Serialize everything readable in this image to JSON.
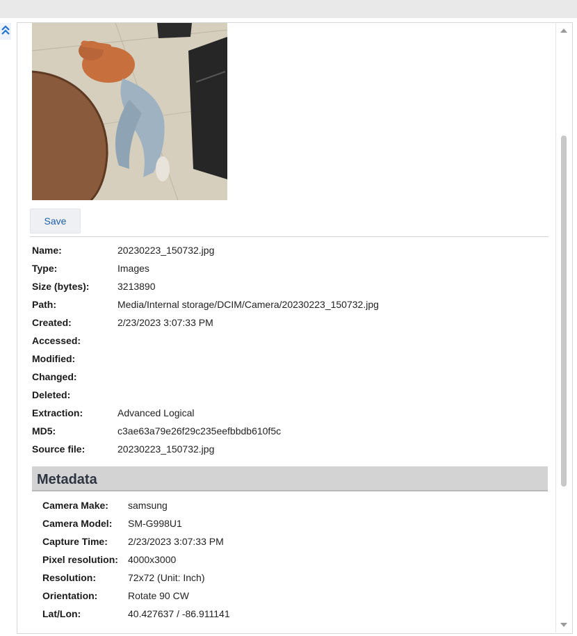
{
  "toolbar": {
    "save_label": "Save"
  },
  "properties": [
    {
      "label": "Name:",
      "value": "20230223_150732.jpg"
    },
    {
      "label": "Type:",
      "value": "Images"
    },
    {
      "label": "Size (bytes):",
      "value": "3213890"
    },
    {
      "label": "Path:",
      "value": "Media/Internal storage/DCIM/Camera/20230223_150732.jpg"
    },
    {
      "label": "Created:",
      "value": "2/23/2023 3:07:33 PM"
    },
    {
      "label": "Accessed:",
      "value": ""
    },
    {
      "label": "Modified:",
      "value": ""
    },
    {
      "label": "Changed:",
      "value": ""
    },
    {
      "label": "Deleted:",
      "value": ""
    },
    {
      "label": "Extraction:",
      "value": "Advanced Logical"
    },
    {
      "label": "MD5:",
      "value": "c3ae63a79e26f29c235eefbbdb610f5c"
    },
    {
      "label": "Source file:",
      "value": "20230223_150732.jpg"
    }
  ],
  "metadata": {
    "title": "Metadata",
    "rows": [
      {
        "label": "Camera Make:",
        "value": "samsung"
      },
      {
        "label": "Camera Model:",
        "value": "SM-G998U1"
      },
      {
        "label": "Capture Time:",
        "value": "2/23/2023 3:07:33 PM"
      },
      {
        "label": "Pixel resolution:",
        "value": "4000x3000"
      },
      {
        "label": "Resolution:",
        "value": "72x72 (Unit: Inch)"
      },
      {
        "label": "Orientation:",
        "value": "Rotate 90 CW"
      },
      {
        "label": "Lat/Lon:",
        "value": "40.427637 / -86.911141"
      }
    ]
  },
  "icons": {
    "collapse": "double-chevron-up-icon",
    "scroll_up": "triangle-up-icon",
    "scroll_down": "triangle-down-icon"
  },
  "colors": {
    "link_blue": "#1f5fae",
    "header_gray": "#d3d3d3"
  }
}
